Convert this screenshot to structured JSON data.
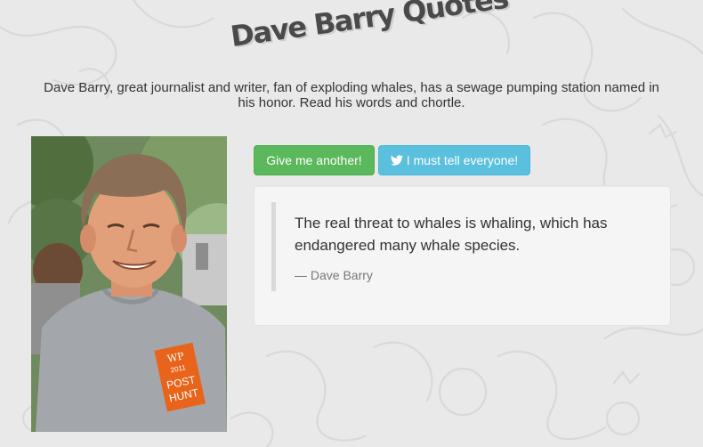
{
  "page": {
    "title": "Dave Barry Quotes",
    "tagline": "Dave Barry, great journalist and writer, fan of exploding whales, has a sewage pumping station named in his honor. Read his words and chortle."
  },
  "photo": {
    "shirt_badge": [
      "WP",
      "2011",
      "POST",
      "HUNT"
    ]
  },
  "buttons": {
    "another_label": "Give me another!",
    "tweet_label": "I must tell everyone!",
    "tweet_icon": "twitter-bird-icon"
  },
  "quote": {
    "text": "The real threat to whales is whaling, which has endangered many whale species.",
    "author": "— Dave Barry"
  },
  "colors": {
    "background": "#e9e9e9",
    "success": "#5cb85c",
    "info": "#5bc0de",
    "well": "#f5f5f5"
  }
}
